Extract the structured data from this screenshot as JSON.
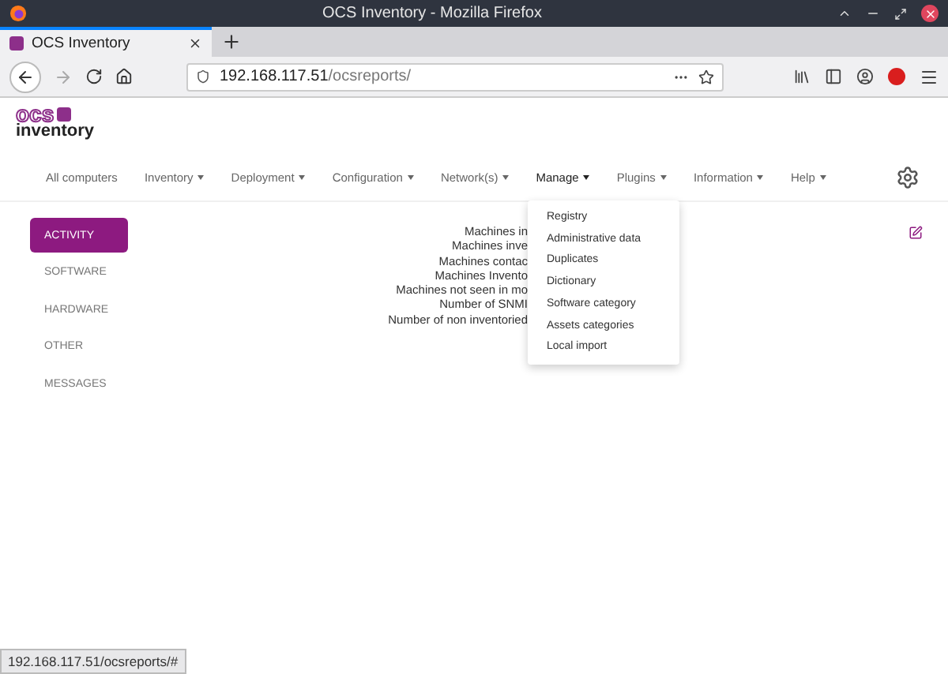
{
  "window": {
    "title": "OCS Inventory - Mozilla Firefox"
  },
  "tabs": [
    {
      "label": "OCS Inventory",
      "selected": true
    }
  ],
  "address_bar": {
    "host": "192.168.117.51",
    "path": "/ocsreports/"
  },
  "logo": {
    "top": "ocs",
    "bottom": "inventory"
  },
  "nav": [
    {
      "label": "All computers",
      "dropdown": false,
      "selected": false
    },
    {
      "label": "Inventory",
      "dropdown": true,
      "selected": false
    },
    {
      "label": "Deployment",
      "dropdown": true,
      "selected": false
    },
    {
      "label": "Configuration",
      "dropdown": true,
      "selected": false
    },
    {
      "label": "Network(s)",
      "dropdown": true,
      "selected": false
    },
    {
      "label": "Manage",
      "dropdown": true,
      "selected": true
    },
    {
      "label": "Plugins",
      "dropdown": true,
      "selected": false
    },
    {
      "label": "Information",
      "dropdown": true,
      "selected": false
    },
    {
      "label": "Help",
      "dropdown": true,
      "selected": false
    }
  ],
  "manage_menu": [
    "Registry",
    "Administrative data",
    "Duplicates",
    "Dictionary",
    "Software category",
    "Assets categories",
    "Local import"
  ],
  "sidebar": [
    {
      "label": "ACTIVITY",
      "selected": true
    },
    {
      "label": "SOFTWARE",
      "selected": false
    },
    {
      "label": "HARDWARE",
      "selected": false
    },
    {
      "label": "OTHER",
      "selected": false
    },
    {
      "label": "MESSAGES",
      "selected": false
    }
  ],
  "stats": [
    "Machines in",
    "Machines inve",
    "Machines contac",
    "Machines Invento",
    "Machines not seen in mo",
    "Number of SNMI",
    "Number of non inventoried"
  ],
  "status_bar": {
    "url": "192.168.117.51/ocsreports/#"
  }
}
